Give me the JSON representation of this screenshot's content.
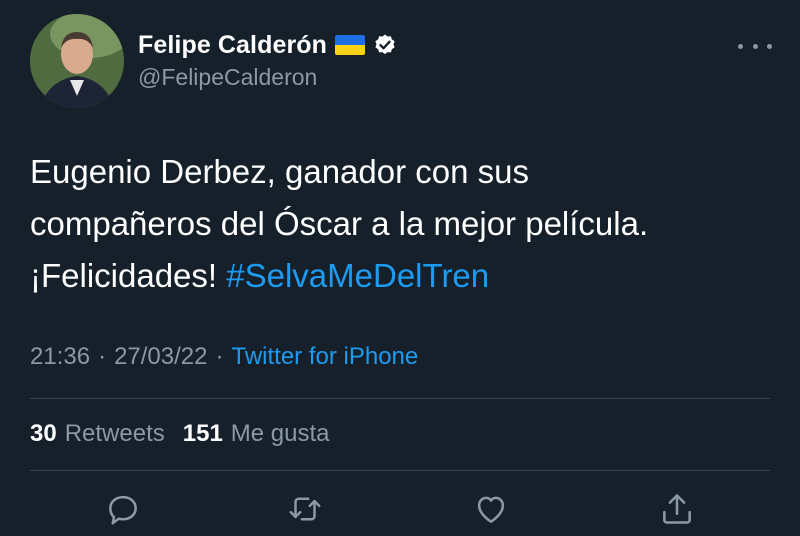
{
  "author": {
    "name": "Felipe Calderón",
    "handle": "@FelipeCalderon"
  },
  "tweet": {
    "text_line1": "Eugenio Derbez, ganador con sus",
    "text_line2": "compañeros del Óscar a la mejor película.",
    "text_line3": "¡Felicidades!",
    "hashtag": "#SelvaMeDelTren"
  },
  "meta": {
    "time": "21:36",
    "date": "27/03/22",
    "separator": "·",
    "source": "Twitter for iPhone"
  },
  "stats": {
    "retweets_count": "30",
    "retweets_label": "Retweets",
    "likes_count": "151",
    "likes_label": "Me gusta"
  },
  "icons": {
    "reply": "comment-icon",
    "retweet": "retweet-icon",
    "like": "heart-icon",
    "share": "share-icon",
    "flag": "ukraine-flag-icon",
    "verified": "verified-badge-icon",
    "more": "more-options-icon"
  },
  "colors": {
    "background": "#15202b",
    "accent": "#1d9bf0",
    "secondary_text": "#8b98a5"
  }
}
